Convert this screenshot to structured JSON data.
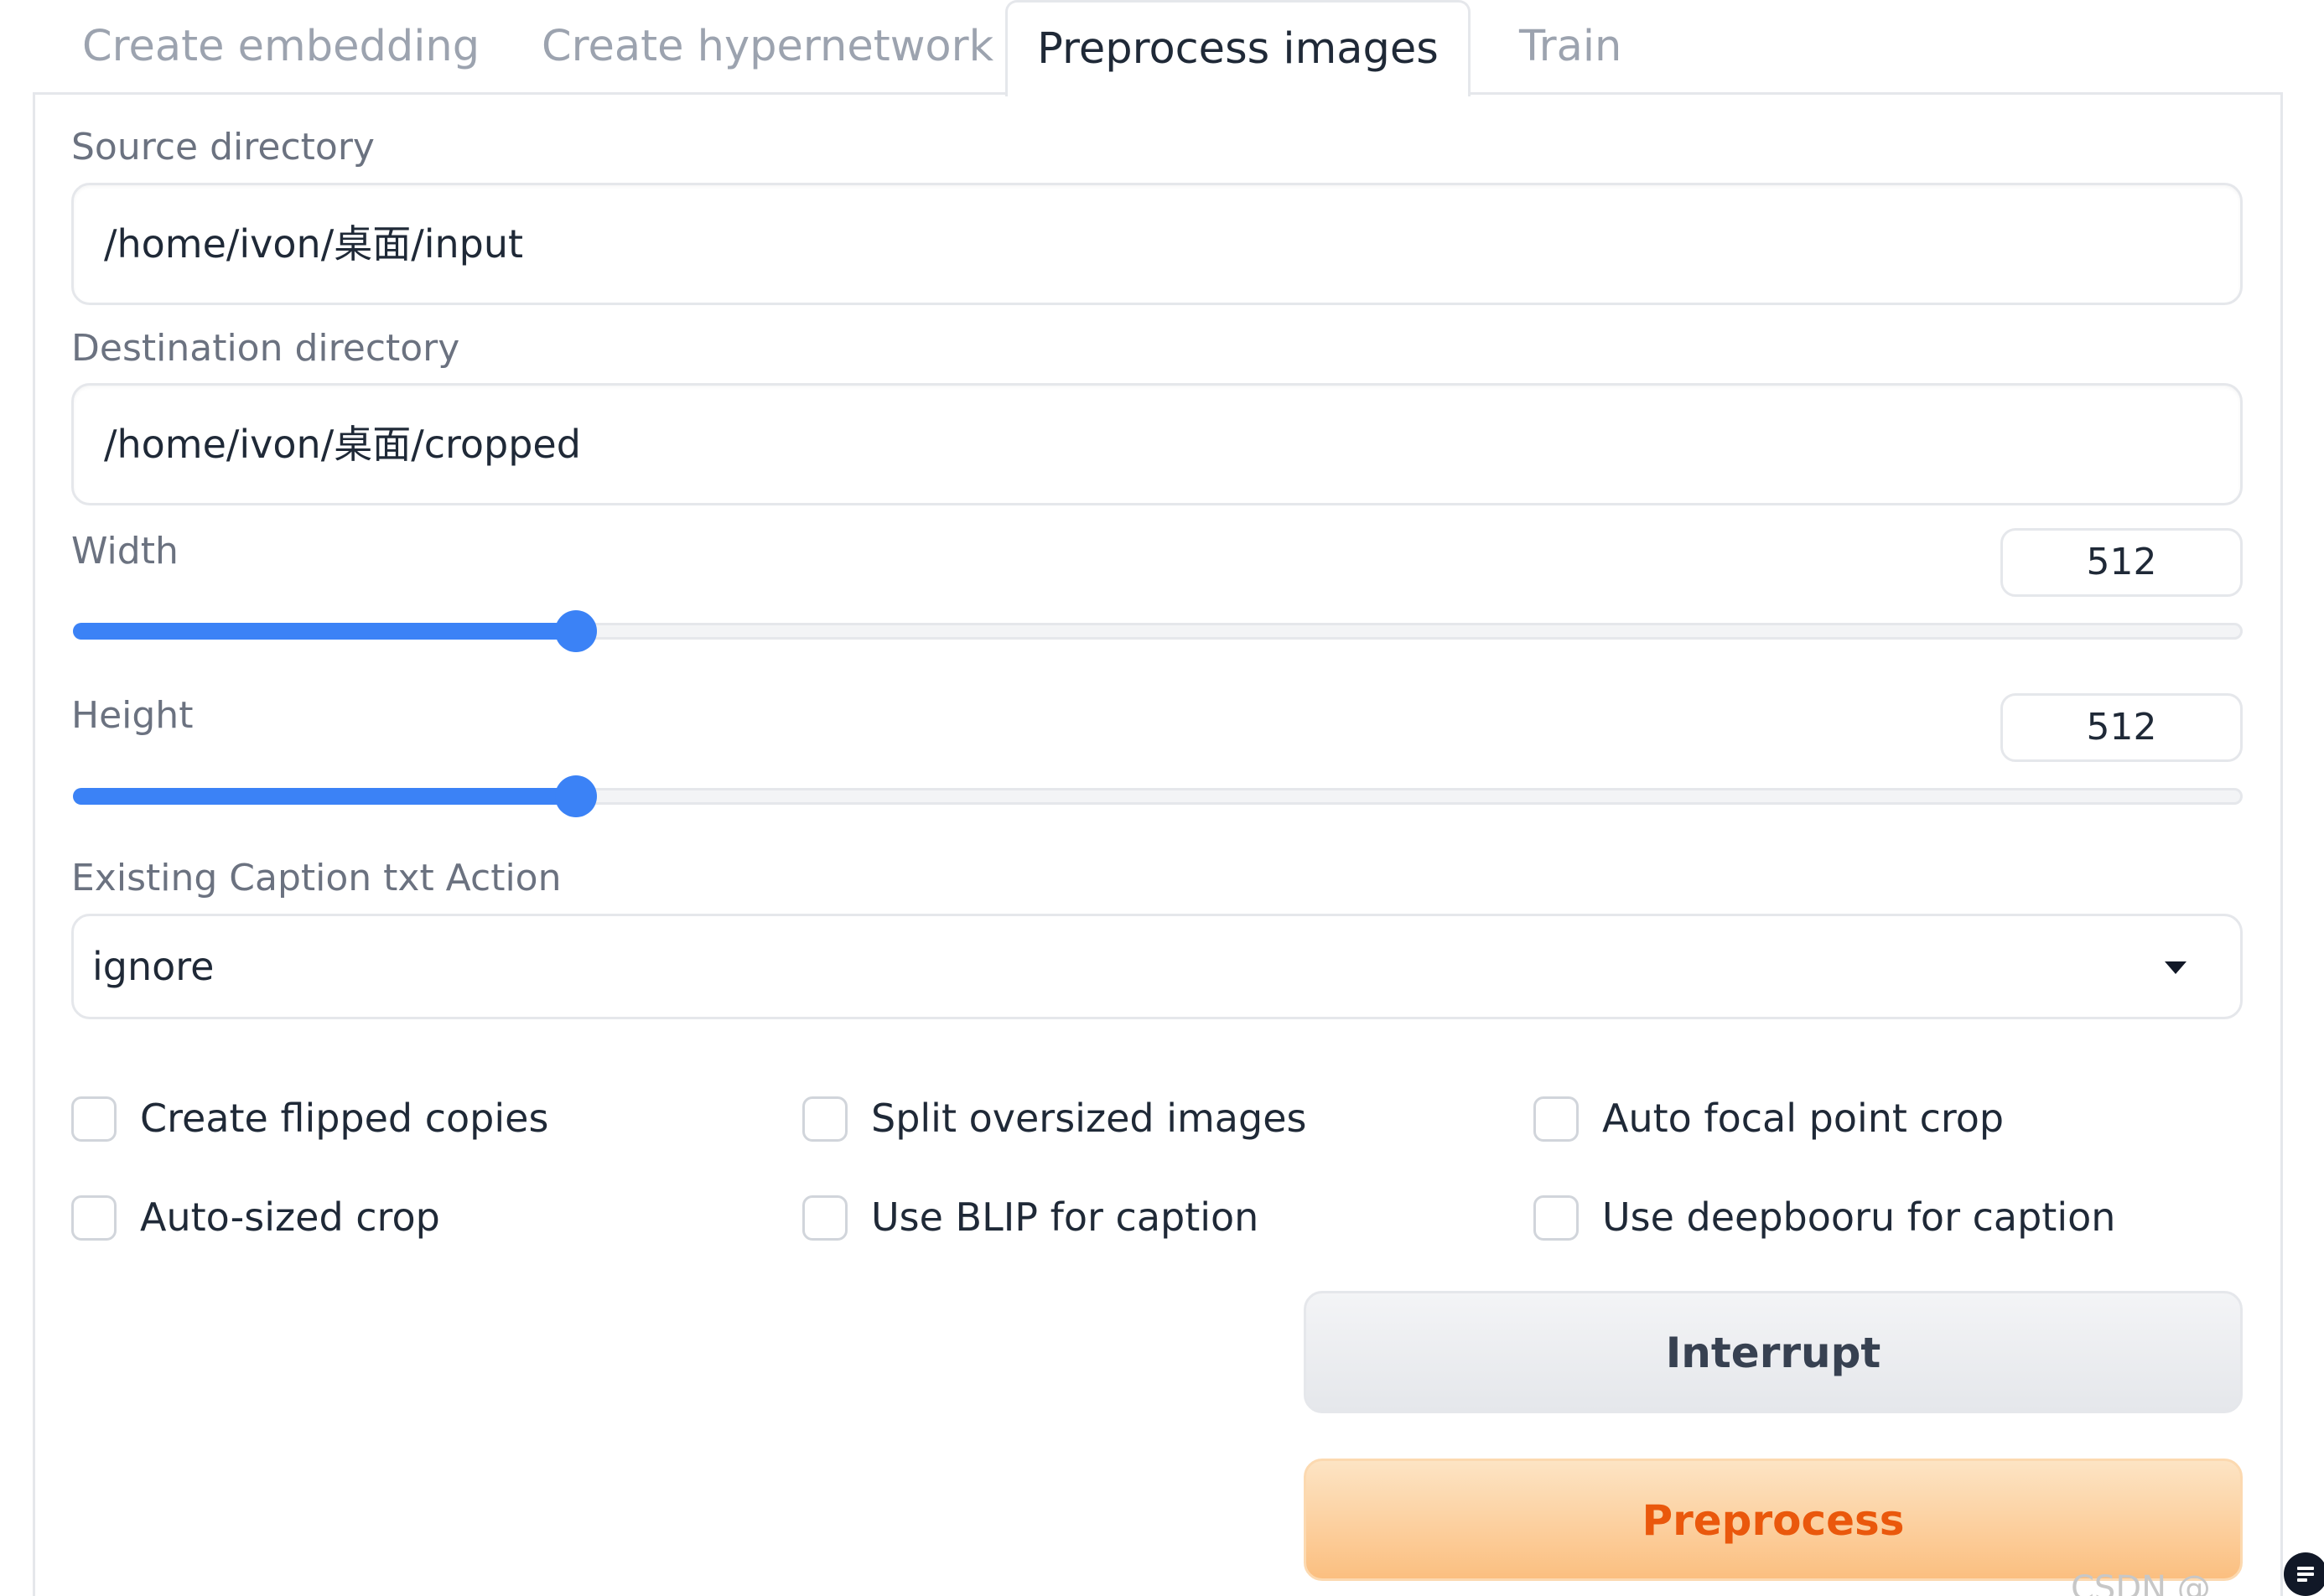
{
  "tabs": [
    {
      "label": "Create embedding",
      "active": false
    },
    {
      "label": "Create hypernetwork",
      "active": false
    },
    {
      "label": "Preprocess images",
      "active": true
    },
    {
      "label": "Train",
      "active": false
    }
  ],
  "form": {
    "source_directory": {
      "label": "Source directory",
      "value": "/home/ivon/桌面/input"
    },
    "destination_directory": {
      "label": "Destination directory",
      "value": "/home/ivon/桌面/cropped"
    },
    "width": {
      "label": "Width",
      "value": "512",
      "slider_fraction": 0.232
    },
    "height": {
      "label": "Height",
      "value": "512",
      "slider_fraction": 0.232
    },
    "caption_action": {
      "label": "Existing Caption txt Action",
      "value": "ignore"
    },
    "checkboxes": [
      {
        "label": "Create flipped copies",
        "checked": false
      },
      {
        "label": "Split oversized images",
        "checked": false
      },
      {
        "label": "Auto focal point crop",
        "checked": false
      },
      {
        "label": "Auto-sized crop",
        "checked": false
      },
      {
        "label": "Use BLIP for caption",
        "checked": false
      },
      {
        "label": "Use deepbooru for caption",
        "checked": false
      }
    ],
    "buttons": {
      "interrupt": "Interrupt",
      "preprocess": "Preprocess"
    }
  },
  "watermark": "CSDN @",
  "colors": {
    "accent": "#3b82f6",
    "primary_button_text": "#ea580c"
  }
}
